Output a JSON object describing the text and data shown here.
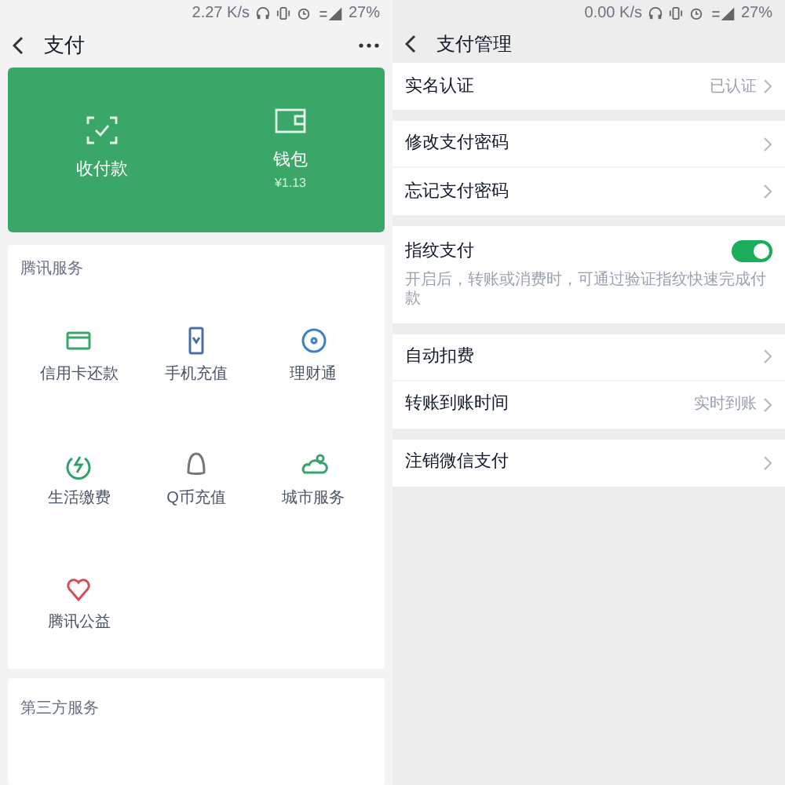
{
  "left": {
    "status_bar": {
      "speed": "2.27 K/s",
      "battery": "27%"
    },
    "header": {
      "title": "支付"
    },
    "wallet_card": {
      "actions": [
        {
          "label": "收付款"
        },
        {
          "label": "钱包",
          "sub": "¥1.13"
        }
      ]
    },
    "services": {
      "title": "腾讯服务",
      "items": [
        {
          "label": "信用卡还款"
        },
        {
          "label": "手机充值"
        },
        {
          "label": "理财通"
        },
        {
          "label": "生活缴费"
        },
        {
          "label": "Q币充值"
        },
        {
          "label": "城市服务"
        },
        {
          "label": "腾讯公益"
        }
      ]
    },
    "third_party": {
      "title": "第三方服务"
    }
  },
  "right": {
    "status_bar": {
      "speed": "0.00 K/s",
      "battery": "27%"
    },
    "header": {
      "title": "支付管理"
    },
    "groups": [
      [
        {
          "kind": "link",
          "label": "实名认证",
          "value": "已认证"
        }
      ],
      [
        {
          "kind": "link",
          "label": "修改支付密码"
        },
        {
          "kind": "link",
          "label": "忘记支付密码"
        }
      ],
      [
        {
          "kind": "toggle",
          "label": "指纹支付",
          "on": true,
          "description": "开启后，转账或消费时，可通过验证指纹快速完成付款"
        }
      ],
      [
        {
          "kind": "link",
          "label": "自动扣费"
        },
        {
          "kind": "link",
          "label": "转账到账时间",
          "value": "实时到账"
        }
      ],
      [
        {
          "kind": "link",
          "label": "注销微信支付"
        }
      ]
    ]
  }
}
